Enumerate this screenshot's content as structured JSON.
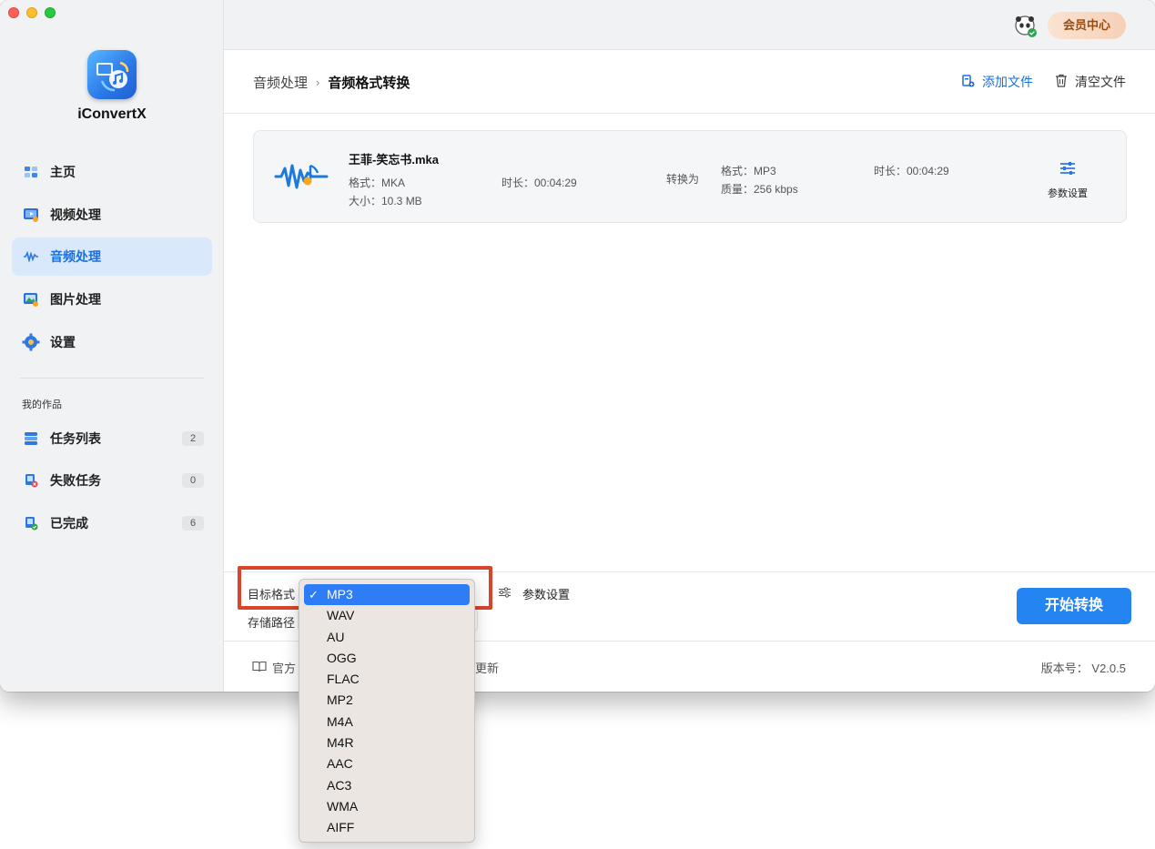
{
  "app": {
    "name": "iConvertX",
    "vip_label": "会员中心"
  },
  "sidebar": {
    "nav": [
      {
        "label": "主页",
        "icon": "home-icon"
      },
      {
        "label": "视频处理",
        "icon": "video-icon"
      },
      {
        "label": "音频处理",
        "icon": "audio-icon",
        "active": true
      },
      {
        "label": "图片处理",
        "icon": "image-icon"
      },
      {
        "label": "设置",
        "icon": "gear-icon"
      }
    ],
    "section_title": "我的作品",
    "works": [
      {
        "label": "任务列表",
        "count": "2",
        "icon": "task-list-icon"
      },
      {
        "label": "失败任务",
        "count": "0",
        "icon": "failed-task-icon"
      },
      {
        "label": "已完成",
        "count": "6",
        "icon": "completed-icon"
      }
    ]
  },
  "header": {
    "breadcrumb_parent": "音频处理",
    "breadcrumb_sep": "›",
    "breadcrumb_current": "音频格式转换",
    "add_file": "添加文件",
    "clear_files": "清空文件"
  },
  "file": {
    "name": "王菲-笑忘书.mka",
    "format": "格式：MKA",
    "size": "大小：10.3 MB",
    "duration": "时长：00:04:29",
    "convert_to": "转换为",
    "out_format": "格式：MP3",
    "out_quality": "质量：256 kbps",
    "out_duration": "时长：00:04:29",
    "param_label": "参数设置"
  },
  "bottom": {
    "target_label": "目标格式",
    "path_label": "存储路径",
    "param_label": "参数设置",
    "start_label": "开始转换"
  },
  "footer": {
    "left_text": "官方",
    "mid_text": "更新",
    "version": "版本号：  V2.0.5"
  },
  "dropdown": {
    "check": "✓",
    "options": [
      "MP3",
      "WAV",
      "AU",
      "OGG",
      "FLAC",
      "MP2",
      "M4A",
      "M4R",
      "AAC",
      "AC3",
      "WMA",
      "AIFF"
    ],
    "selected": "MP3"
  },
  "colors": {
    "accent": "#2484f2",
    "active_nav_bg": "#d9e8fb",
    "highlight": "#d9442b",
    "vip": "#9a4b10"
  }
}
